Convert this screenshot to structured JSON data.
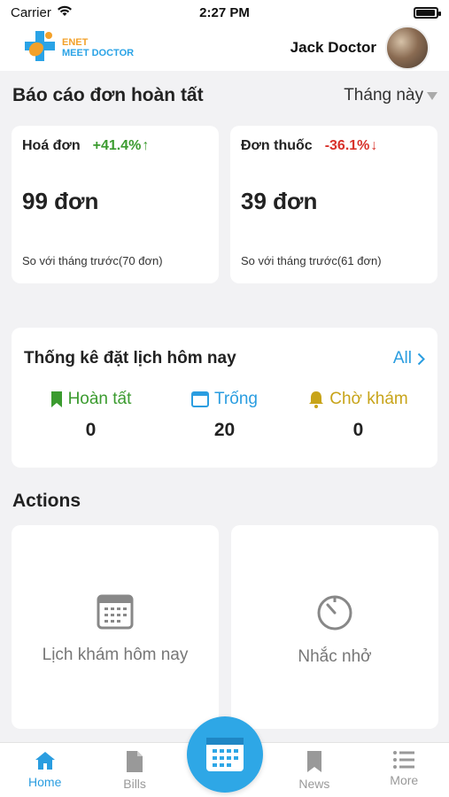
{
  "status_bar": {
    "carrier": "Carrier",
    "time": "2:27 PM",
    "battery_level": 0.95
  },
  "header": {
    "logo_line1": "ENET",
    "logo_line2": "MEET DOCTOR",
    "user_name": "Jack Doctor"
  },
  "report": {
    "title": "Báo cáo đơn hoàn tất",
    "period": "Tháng này",
    "cards": [
      {
        "label": "Hoá đơn",
        "change": "+41.4%",
        "direction": "up",
        "value": "99 đơn",
        "compare": "So với tháng trước(70 đơn)"
      },
      {
        "label": "Đơn thuốc",
        "change": "-36.1%",
        "direction": "down",
        "value": "39 đơn",
        "compare": "So với tháng trước(61 đơn)"
      }
    ]
  },
  "booking": {
    "title": "Thống kê đặt lịch hôm nay",
    "all_label": "All",
    "stats": [
      {
        "label": "Hoàn tất",
        "value": "0",
        "icon": "bookmark-icon",
        "color": "#3b9b2f"
      },
      {
        "label": "Trống",
        "value": "20",
        "icon": "window-icon",
        "color": "#2a9de0"
      },
      {
        "label": "Chờ khám",
        "value": "0",
        "icon": "bell-icon",
        "color": "#c8a41a"
      }
    ]
  },
  "actions": {
    "title": "Actions",
    "items": [
      {
        "label": "Lịch khám hôm nay",
        "icon": "calendar-icon"
      },
      {
        "label": "Nhắc nhở",
        "icon": "timer-icon"
      }
    ]
  },
  "tabbar": {
    "tabs": [
      {
        "label": "Home",
        "icon": "home-icon",
        "active": true
      },
      {
        "label": "Bills",
        "icon": "document-icon",
        "active": false
      },
      {
        "label": "News",
        "icon": "bookmark-icon",
        "active": false
      },
      {
        "label": "More",
        "icon": "list-icon",
        "active": false
      }
    ],
    "center_icon": "calendar-icon"
  },
  "colors": {
    "accent": "#2a9de0",
    "positive": "#3b9b2f",
    "negative": "#d8322b",
    "pending": "#c8a41a"
  }
}
